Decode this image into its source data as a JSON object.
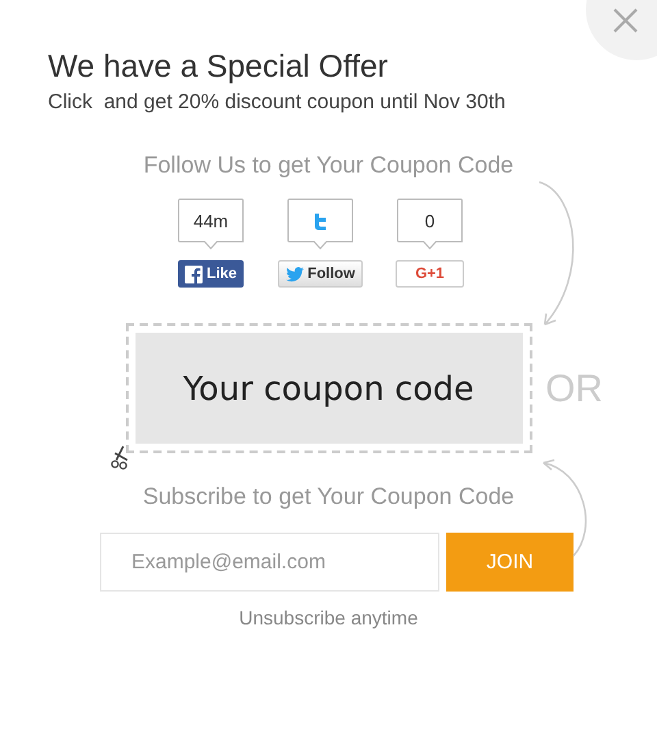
{
  "title": "We have a Special Offer",
  "subtitle": "Click  and get 20% discount coupon until Nov 30th",
  "follow_heading": "Follow Us to get Your Coupon Code",
  "social": [
    {
      "kind": "facebook",
      "count": "44m",
      "label": "Like"
    },
    {
      "kind": "twitter",
      "label": "Follow"
    },
    {
      "kind": "google",
      "count": "0",
      "label": "G+1"
    }
  ],
  "coupon": {
    "code": "Your coupon code",
    "or": "OR"
  },
  "subscribe_heading": "Subscribe to get Your Coupon Code",
  "email": {
    "placeholder": "Example@email.com"
  },
  "join_button": "JOIN",
  "unsubscribe_note": "Unsubscribe anytime"
}
